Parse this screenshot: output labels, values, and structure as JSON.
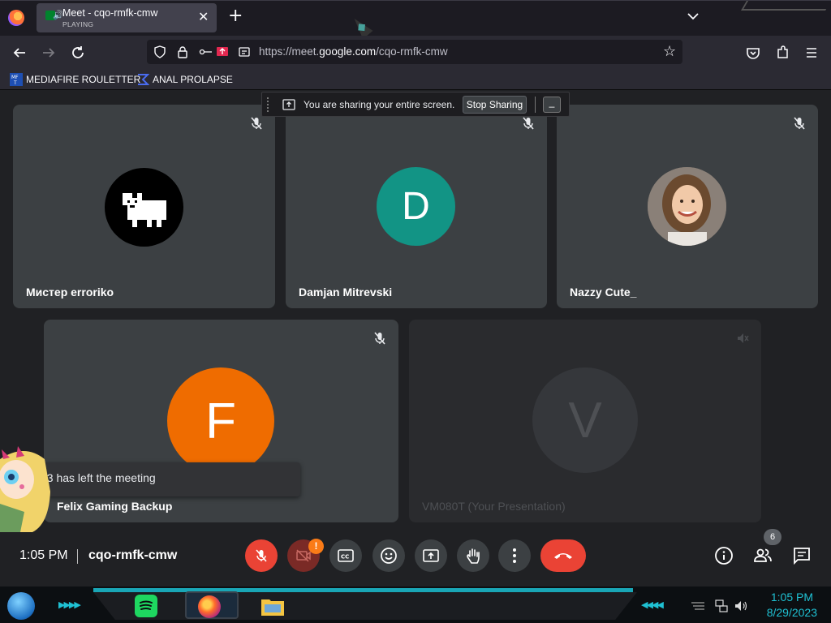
{
  "browser": {
    "tab": {
      "title": "Meet - cqo-rmfk-cmw",
      "status": "PLAYING",
      "close": "✕"
    },
    "new_tab": "+",
    "url": {
      "prefix": "https://meet.",
      "domain": "google.com",
      "path": "/cqo-rmfk-cmw"
    },
    "bookmarks": [
      {
        "label": "MEDIAFIRE ROULETTER",
        "icon": "mediafire-icon"
      },
      {
        "label": "ANAL PROLAPSE",
        "icon": "sigma-icon"
      }
    ]
  },
  "share_bar": {
    "message": "You are sharing your entire screen.",
    "stop_label": "Stop Sharing",
    "minimize_label": "_"
  },
  "participants": [
    {
      "name": "Мистер erroriko",
      "avatar_type": "image",
      "avatar_desc": "dog-pixel-icon"
    },
    {
      "name": "Damjan Mitrevski",
      "avatar_type": "letter",
      "letter": "D",
      "color": "#129485"
    },
    {
      "name": "Nazzy Cute_",
      "avatar_type": "image",
      "avatar_desc": "girl-photo"
    },
    {
      "name": "Felix Gaming Backup",
      "avatar_type": "letter",
      "letter": "F",
      "color": "#ef6c00"
    },
    {
      "name": "VM080T (Your Presentation)",
      "avatar_type": "letter",
      "letter": "V",
      "color": "#3c4043"
    }
  ],
  "toast": {
    "message": "n3 has left the meeting"
  },
  "meeting": {
    "time": "1:05 PM",
    "code": "cqo-rmfk-cmw",
    "people_count": "6",
    "camera_alert": "!"
  },
  "taskbar": {
    "time": "1:05 PM",
    "date": "8/29/2023"
  }
}
